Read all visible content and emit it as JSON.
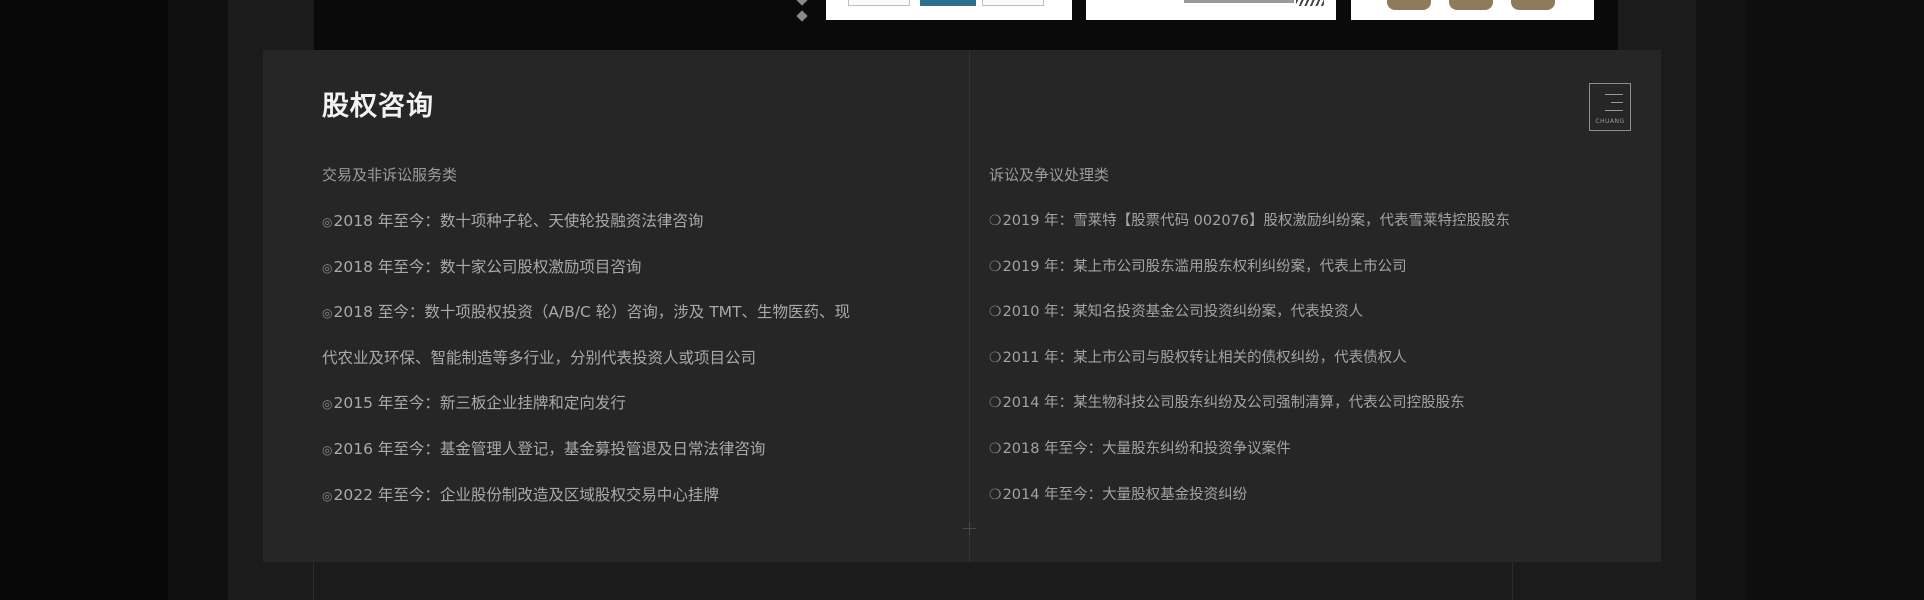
{
  "section": {
    "title": "股权咨询",
    "logo_text": "CHUANG"
  },
  "left_column": {
    "heading": "交易及非诉讼服务类",
    "bullet": "◎",
    "items": [
      "2018 年至今：数十项种子轮、天使轮投融资法律咨询",
      "2018 年至今：数十家公司股权激励项目咨询",
      "2018 至今：数十项股权投资（A/B/C 轮）咨询，涉及 TMT、生物医药、现",
      "代农业及环保、智能制造等多行业，分别代表投资人或项目公司",
      "2015 年至今：新三板企业挂牌和定向发行",
      "2016 年至今：基金管理人登记，基金募投管退及日常法律咨询",
      "2022 年至今：企业股份制改造及区域股权交易中心挂牌"
    ]
  },
  "right_column": {
    "heading": "诉讼及争议处理类",
    "bullet": "❍",
    "items": [
      "2019 年：雪莱特【股票代码 002076】股权激励纠纷案，代表雪莱特控股股东",
      "2019 年：某上市公司股东滥用股东权利纠纷案，代表上市公司",
      "2010 年：某知名投资基金公司投资纠纷案，代表投资人",
      "2011 年：某上市公司与股权转让相关的债权纠纷，代表债权人",
      "2014 年：某生物科技公司股东纠纷及公司强制清算，代表公司控股股东",
      "2018 年至今：大量股东纠纷和投资争议案件",
      "2014 年至今：大量股权基金投资纠纷"
    ]
  }
}
